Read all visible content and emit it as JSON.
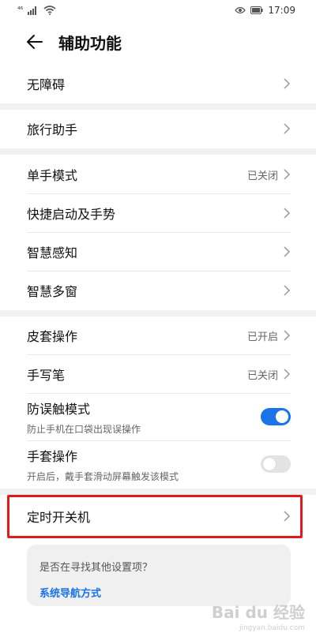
{
  "status_bar": {
    "left_text": "⁴⁶",
    "time": "17:09"
  },
  "header": {
    "title": "辅助功能"
  },
  "menu": {
    "barrier_free": "无障碍",
    "travel_assistant": "旅行助手",
    "one_hand": {
      "label": "单手模式",
      "status": "已关闭"
    },
    "quick_start": "快捷启动及手势",
    "smart_sense": "智慧感知",
    "smart_multiwindow": "智慧多窗",
    "cover_op": {
      "label": "皮套操作",
      "status": "已开启"
    },
    "stylus": {
      "label": "手写笔",
      "status": "已关闭"
    },
    "anti_mistouch": {
      "label": "防误触模式",
      "desc": "防止手机在口袋出现误操作",
      "enabled": true
    },
    "glove_mode": {
      "label": "手套操作",
      "desc": "开启后，戴手套滑动屏幕触发该模式",
      "enabled": false
    },
    "scheduled_power": "定时开关机"
  },
  "suggestion": {
    "question": "是否在寻找其他设置项？",
    "link": "系统导航方式"
  },
  "watermark": {
    "brand": "Bai du 经验",
    "domain": "jingyan.baidu.com"
  },
  "colors": {
    "accent": "#1a73e8",
    "highlight_border": "#e11b1b",
    "section_gap": "#f1f1f1"
  }
}
